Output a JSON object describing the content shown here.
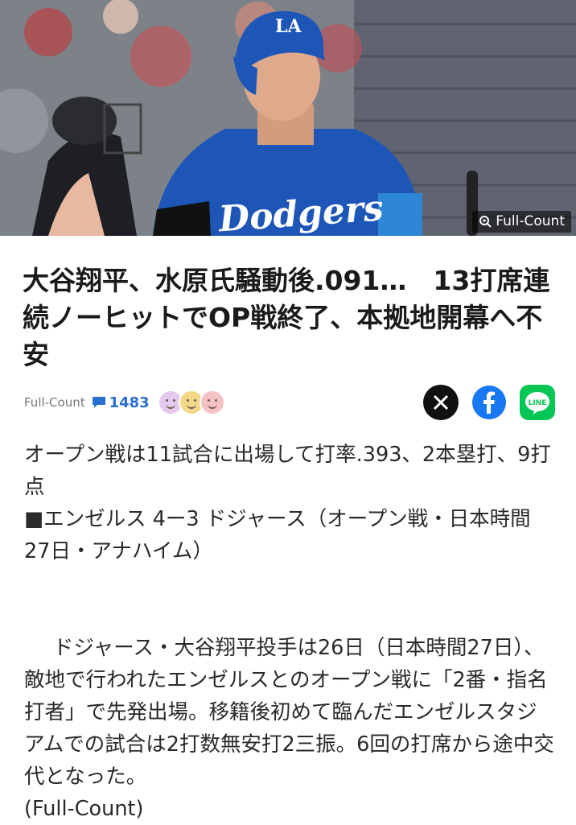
{
  "hero": {
    "image_alt": "Dodgers player in blue jersey and helmet at bat",
    "jersey_text": "Dodgers",
    "helmet_logo": "LA",
    "credit": "Full-Count",
    "credit_icon": "zoom-icon"
  },
  "article": {
    "title": "大谷翔平、水原氏騒動後.091…　13打席連続ノーヒットでOP戦終了、本拠地開幕へ不安",
    "source": "Full-Count",
    "comment_count": "1483",
    "share": [
      "x-icon",
      "facebook-icon",
      "line-icon"
    ],
    "paragraph1": "オープン戦は11試合に出場して打率.393、2本塁打、9打点",
    "paragraph2": "■エンゼルス 4ー3 ドジャース（オープン戦・日本時間27日・アナハイム）",
    "paragraph3": "ドジャース・大谷翔平投手は26日（日本時間27日）、敵地で行われたエンゼルスとのオープン戦に「2番・指名打者」で先発出場。移籍後初めて臨んだエンゼルスタジアムでの試合は2打数無安打2三振。6回の打席から途中交代となった。",
    "paragraph4": "(Full-Count)"
  },
  "colors": {
    "dodger_blue": "#1e56b8",
    "comment_blue": "#2a6fd0",
    "facebook_blue": "#1877f2",
    "line_green": "#06c755"
  }
}
